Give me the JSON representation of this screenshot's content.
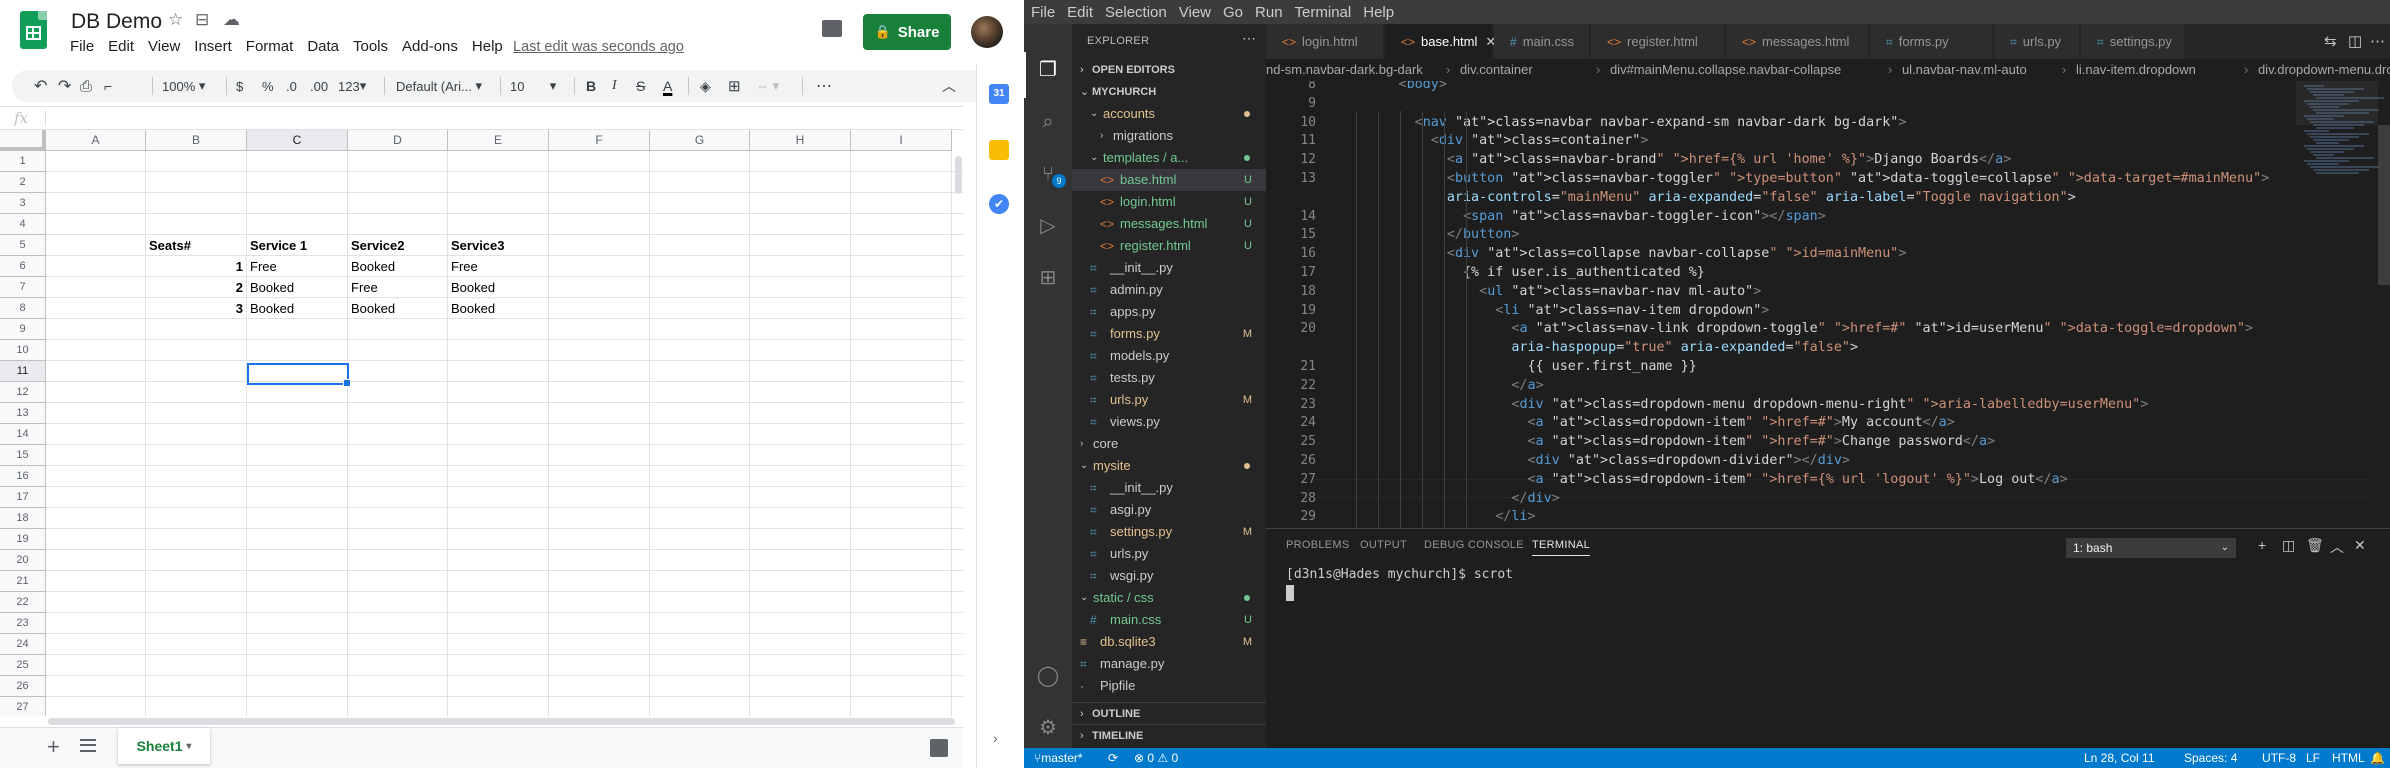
{
  "sheets": {
    "doc_title": "DB Demo",
    "menu": [
      "File",
      "Edit",
      "View",
      "Insert",
      "Format",
      "Data",
      "Tools",
      "Add-ons",
      "Help"
    ],
    "last_edit": "Last edit was seconds ago",
    "share_label": "Share",
    "toolbar": {
      "zoom": "100%",
      "currency": "$",
      "percent": "%",
      "dec_less": ".0",
      "dec_more": ".00",
      "more_formats": "123",
      "font": "Default (Ari...",
      "font_size": "10",
      "bold": "B",
      "italic": "I",
      "strike": "S",
      "text_color": "A",
      "more": "⋯"
    },
    "fx": "fx",
    "columns": [
      "A",
      "B",
      "C",
      "D",
      "E",
      "F",
      "G",
      "H",
      "I"
    ],
    "rows": [
      "1",
      "2",
      "3",
      "4",
      "5",
      "6",
      "7",
      "8",
      "9",
      "10",
      "11",
      "12",
      "13",
      "14",
      "15",
      "16",
      "17",
      "18",
      "19",
      "20",
      "21",
      "22",
      "23",
      "24",
      "25",
      "26",
      "27"
    ],
    "selected_cell": "C11",
    "cells": {
      "B5": "Seats#",
      "C5": "Service 1",
      "D5": "Service2",
      "E5": "Service3",
      "B6": "1",
      "C6": "Free",
      "D6": "Booked",
      "E6": "Free",
      "B7": "2",
      "C7": "Booked",
      "D7": "Free",
      "E7": "Booked",
      "B8": "3",
      "C8": "Booked",
      "D8": "Booked",
      "E8": "Booked"
    },
    "sheet_tab": "Sheet1",
    "add_sheet": "+",
    "colors": {
      "share": "#188038",
      "selection": "#1a73e8"
    }
  },
  "vscode": {
    "menu": [
      "File",
      "Edit",
      "Selection",
      "View",
      "Go",
      "Run",
      "Terminal",
      "Help"
    ],
    "explorer_title": "EXPLORER",
    "open_editors": "OPEN EDITORS",
    "project": "MYCHURCH",
    "outline": "OUTLINE",
    "timeline": "TIMELINE",
    "scm_badge": "9",
    "tree": [
      {
        "label": "accounts",
        "status": "dot"
      },
      {
        "label": "migrations",
        "status": ""
      },
      {
        "label": "templates / a...",
        "status": "dot"
      },
      {
        "label": "base.html",
        "status": "U"
      },
      {
        "label": "login.html",
        "status": "U"
      },
      {
        "label": "messages.html",
        "status": "U"
      },
      {
        "label": "register.html",
        "status": "U"
      },
      {
        "label": "__init__.py",
        "status": ""
      },
      {
        "label": "admin.py",
        "status": ""
      },
      {
        "label": "apps.py",
        "status": ""
      },
      {
        "label": "forms.py",
        "status": "M"
      },
      {
        "label": "models.py",
        "status": ""
      },
      {
        "label": "tests.py",
        "status": ""
      },
      {
        "label": "urls.py",
        "status": "M"
      },
      {
        "label": "views.py",
        "status": ""
      },
      {
        "label": "core",
        "status": ""
      },
      {
        "label": "mysite",
        "status": "dot"
      },
      {
        "label": "__init__.py",
        "status": ""
      },
      {
        "label": "asgi.py",
        "status": ""
      },
      {
        "label": "settings.py",
        "status": "M"
      },
      {
        "label": "urls.py",
        "status": ""
      },
      {
        "label": "wsgi.py",
        "status": ""
      },
      {
        "label": "static / css",
        "status": "dot"
      },
      {
        "label": "main.css",
        "status": "U"
      },
      {
        "label": "db.sqlite3",
        "status": "M"
      },
      {
        "label": "manage.py",
        "status": ""
      },
      {
        "label": "Pipfile",
        "status": ""
      }
    ],
    "tabs": [
      "login.html",
      "base.html",
      "main.css",
      "register.html",
      "messages.html",
      "forms.py",
      "urls.py",
      "settings.py"
    ],
    "active_tab": "base.html",
    "breadcrumb": [
      "nd-sm.navbar-dark.bg-dark",
      "div.container",
      "div#mainMenu.collapse.navbar-collapse",
      "ul.navbar-nav.ml-auto",
      "li.nav-item.dropdown",
      "div.dropdown-menu.dropdown-menu-rig"
    ],
    "line_numbers": [
      "8",
      "9",
      "10",
      "11",
      "12",
      "13",
      "",
      "14",
      "15",
      "16",
      "17",
      "18",
      "19",
      "20",
      "",
      "21",
      "22",
      "23",
      "24",
      "25",
      "26",
      "27",
      "28",
      "29"
    ],
    "code_lines": [
      "        <body>",
      "",
      "          <nav class=\"navbar navbar-expand-sm navbar-dark bg-dark\">",
      "            <div class=\"container\">",
      "              <a class=\"navbar-brand\" href=\"{% url 'home' %}\">Django Boards</a>",
      "              <button class=\"navbar-toggler\" type=\"button\" data-toggle=\"collapse\" data-target=\"#mainMenu\"",
      "              aria-controls=\"mainMenu\" aria-expanded=\"false\" aria-label=\"Toggle navigation\">",
      "                <span class=\"navbar-toggler-icon\"></span>",
      "              </button>",
      "              <div class=\"collapse navbar-collapse\" id=\"mainMenu\">",
      "                {% if user.is_authenticated %}",
      "                  <ul class=\"navbar-nav ml-auto\">",
      "                    <li class=\"nav-item dropdown\">",
      "                      <a class=\"nav-link dropdown-toggle\" href=\"#\" id=\"userMenu\" data-toggle=\"dropdown\"",
      "                      aria-haspopup=\"true\" aria-expanded=\"false\">",
      "                        {{ user.first_name }}",
      "                      </a>",
      "                      <div class=\"dropdown-menu dropdown-menu-right\" aria-labelledby=\"userMenu\">",
      "                        <a class=\"dropdown-item\" href=\"#\">My account</a>",
      "                        <a class=\"dropdown-item\" href=\"#\">Change password</a>",
      "                        <div class=\"dropdown-divider\"></div>",
      "                        <a class=\"dropdown-item\" href=\"{% url 'logout' %}\">Log out</a>",
      "                      </div>",
      "                    </li>"
    ],
    "panel_tabs": [
      "PROBLEMS",
      "OUTPUT",
      "DEBUG CONSOLE",
      "TERMINAL"
    ],
    "active_panel": "TERMINAL",
    "terminal_select": "1: bash",
    "terminal_text": "[d3n1s@Hades mychurch]$ scrot",
    "status": {
      "branch": "master*",
      "problems": "⊗ 0 ⚠ 0",
      "position": "Ln 28, Col 11",
      "spaces": "Spaces: 4",
      "encoding": "UTF-8",
      "eol": "LF",
      "language": "HTML"
    },
    "colors": {
      "statusbar": "#007acc",
      "html_icon": "#e37933",
      "py_icon": "#519aba",
      "untracked": "#73c991",
      "modified": "#e2c08d"
    }
  }
}
